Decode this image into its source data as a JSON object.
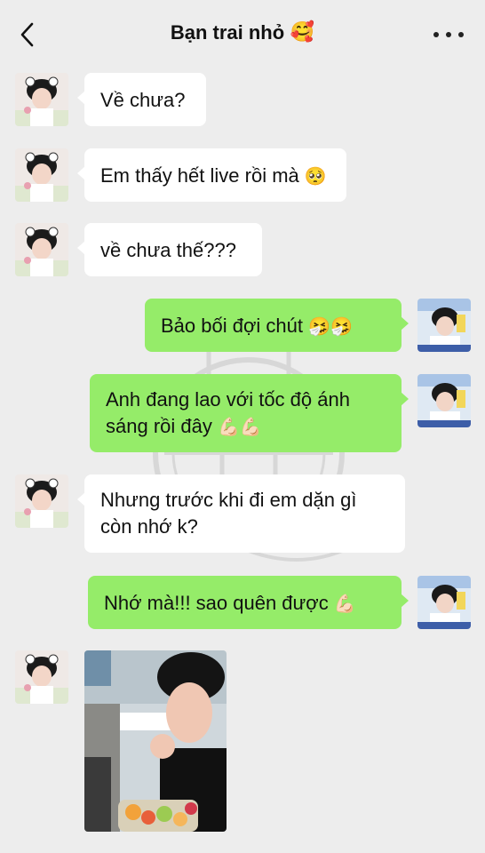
{
  "header": {
    "title": "Bạn trai nhỏ",
    "title_emoji": "🥰",
    "back_icon": "chevron-left-icon",
    "more_icon": "ellipsis-icon"
  },
  "colors": {
    "background": "#ededed",
    "bubble_incoming": "#ffffff",
    "bubble_outgoing": "#95ec69",
    "text": "#111111"
  },
  "messages": [
    {
      "side": "left",
      "line1": "Về chưa?"
    },
    {
      "side": "left",
      "line1": "Em thấy hết live rồi mà",
      "emoji": "🥺"
    },
    {
      "side": "left",
      "line1": "về chưa thế???"
    },
    {
      "side": "right",
      "line1": "Bảo bối đợi chút",
      "emoji": "🤧🤧"
    },
    {
      "side": "right",
      "line1": "Anh đang lao với tốc độ ánh",
      "line2": "sáng rồi đây",
      "emoji": "💪🏻💪🏻"
    },
    {
      "side": "left",
      "line1": "Nhưng trước khi đi em dặn gì",
      "line2": "còn nhớ k?"
    },
    {
      "side": "right",
      "line1": "Nhớ mà!!! sao quên được",
      "emoji": "💪🏻"
    },
    {
      "side": "left",
      "type": "image",
      "image_desc": "photo-message"
    }
  ]
}
